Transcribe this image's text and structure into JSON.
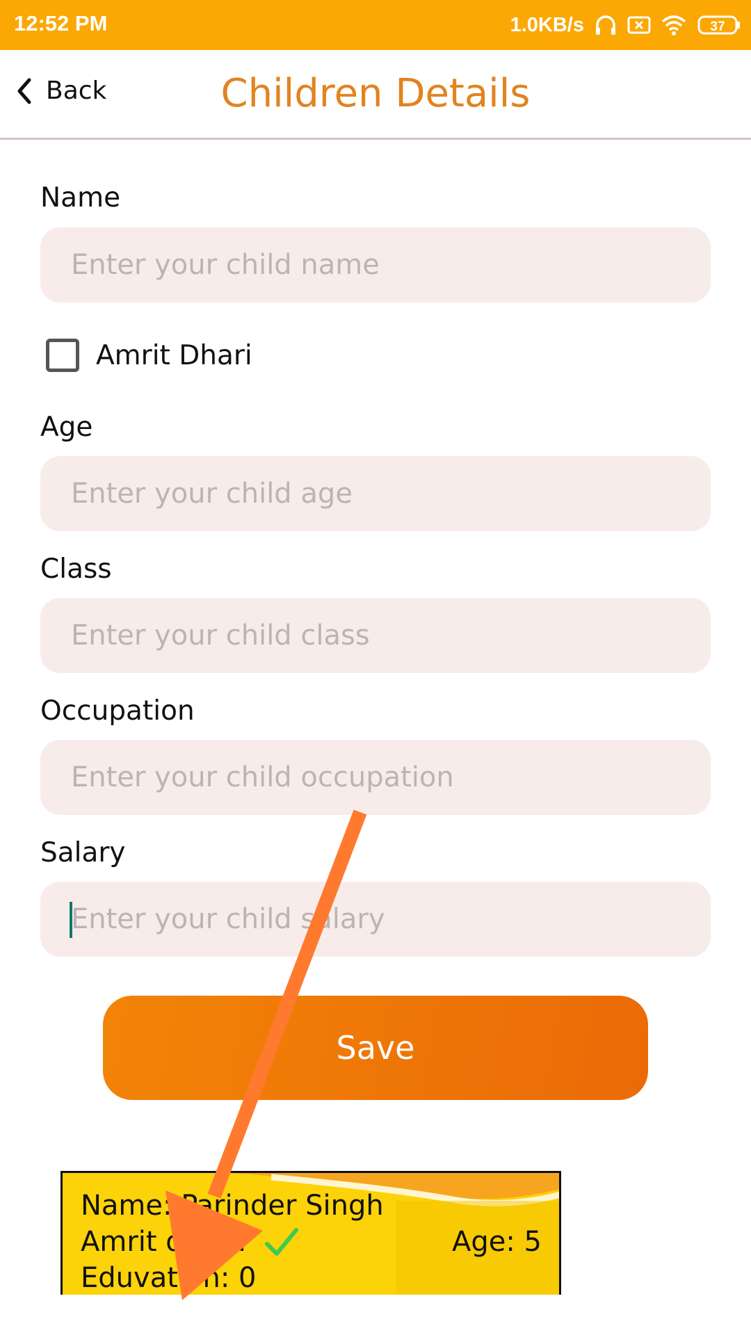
{
  "status_bar": {
    "time": "12:52 PM",
    "net_speed": "1.0KB/s",
    "battery_level": "37",
    "icons": [
      "headphones-icon",
      "sim-off-icon",
      "wifi-icon",
      "battery-icon"
    ]
  },
  "header": {
    "back_label": "Back",
    "title": "Children Details"
  },
  "form": {
    "name": {
      "label": "Name",
      "placeholder": "Enter your child name",
      "value": ""
    },
    "amrit_dhari": {
      "label": "Amrit Dhari",
      "checked": false
    },
    "age": {
      "label": "Age",
      "placeholder": "Enter your child age",
      "value": ""
    },
    "class": {
      "label": "Class",
      "placeholder": "Enter your child class",
      "value": ""
    },
    "occupation": {
      "label": "Occupation",
      "placeholder": "Enter your child occupation",
      "value": ""
    },
    "salary": {
      "label": "Salary",
      "placeholder": "Enter your child salary",
      "value": ""
    },
    "save_label": "Save"
  },
  "preview_card": {
    "name_line": "Name: Parinder Singh",
    "amrit_line": "Amrit dhari:",
    "age_line": "Age: 5",
    "education_line": "Eduvation: 0"
  },
  "colors": {
    "status_bar": "#FBA805",
    "title": "#E2831F",
    "input_bg": "#F8ECEB",
    "button_start": "#F28407",
    "button_end": "#EB6A07",
    "card_bg": "#FCD209",
    "arrow": "#FF7A2E"
  }
}
